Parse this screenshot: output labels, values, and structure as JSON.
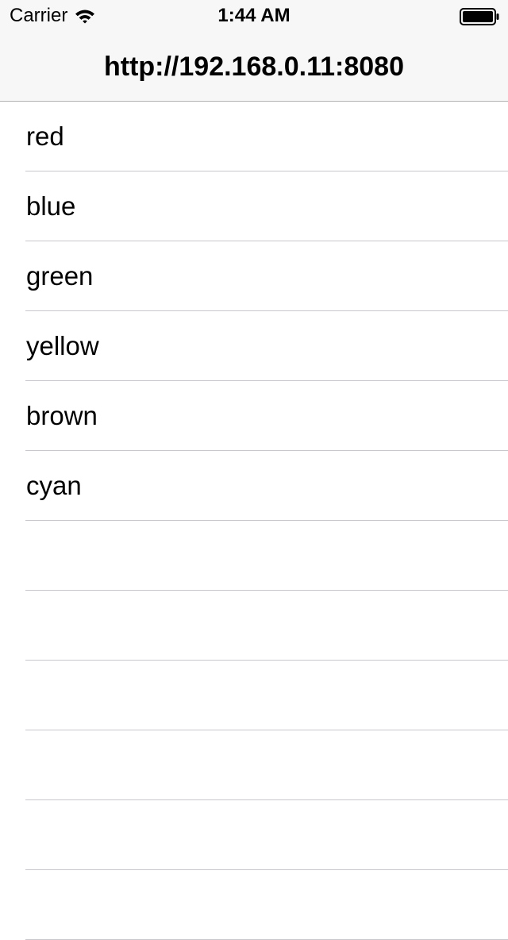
{
  "status_bar": {
    "carrier": "Carrier",
    "time": "1:44 AM",
    "icons": [
      "wifi-icon",
      "battery-icon"
    ]
  },
  "nav": {
    "title": "http://192.168.0.11:8080"
  },
  "list": {
    "items": [
      "red",
      "blue",
      "green",
      "yellow",
      "brown",
      "cyan",
      "",
      "",
      "",
      "",
      "",
      ""
    ]
  },
  "colors": {
    "header_background": "#f7f7f7",
    "separator": "#c8c7cc",
    "text": "#000000"
  }
}
